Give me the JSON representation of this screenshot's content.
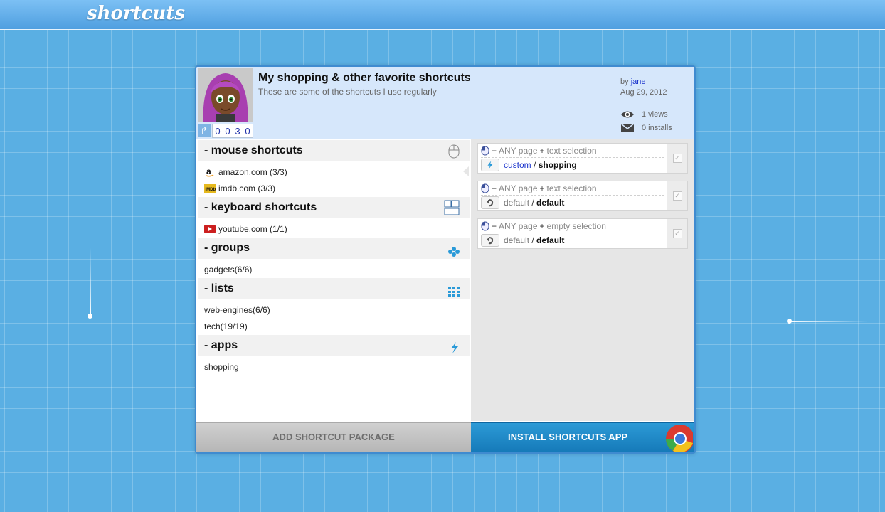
{
  "app": {
    "logo": "shortcuts"
  },
  "package": {
    "title": "My shopping & other favorite shortcuts",
    "subtitle": "These are some of the shortcuts I use regularly",
    "counter": [
      "0",
      "0",
      "3",
      "0"
    ],
    "by_prefix": "by",
    "author": "jane",
    "date": "Aug 29, 2012",
    "views": "1 views",
    "installs": "0 installs"
  },
  "sections": {
    "mouse": {
      "title": "- mouse shortcuts",
      "icon": "mouse-icon",
      "items": [
        {
          "label": "amazon.com (3/3)",
          "icon": "amazon-favicon"
        },
        {
          "label": "imdb.com (3/3)",
          "icon": "imdb-favicon"
        }
      ]
    },
    "keyboard": {
      "title": "- keyboard shortcuts",
      "icon": "keyboard-icon",
      "items": [
        {
          "label": "youtube.com (1/1)",
          "icon": "youtube-favicon"
        }
      ]
    },
    "groups": {
      "title": "- groups",
      "icon": "groups-icon",
      "items": [
        {
          "label": "gadgets(6/6)"
        }
      ]
    },
    "lists": {
      "title": "- lists",
      "icon": "grid-icon",
      "items": [
        {
          "label": "web-engines(6/6)"
        },
        {
          "label": "tech(19/19)"
        }
      ]
    },
    "apps": {
      "title": "- apps",
      "icon": "lightning-icon",
      "items": [
        {
          "label": "shopping"
        }
      ]
    }
  },
  "shortcuts": [
    {
      "plus": "+",
      "page": "ANY page",
      "plus2": "+",
      "selection": "text selection",
      "source": "custom",
      "sep": " / ",
      "action": "shopping",
      "badge_icon": "lightning-icon"
    },
    {
      "plus": "+",
      "page": "ANY page",
      "plus2": "+",
      "selection": "text selection",
      "source": "default",
      "sep": " / ",
      "action": "default",
      "badge_icon": "undo-icon"
    },
    {
      "plus": "+",
      "page": "ANY page",
      "plus2": "+",
      "selection": "empty selection",
      "source": "default",
      "sep": " / ",
      "action": "default",
      "badge_icon": "undo-icon"
    }
  ],
  "buttons": {
    "add": "ADD SHORTCUT PACKAGE",
    "install": "INSTALL SHORTCUTS APP"
  },
  "colors": {
    "accent": "#1579b8",
    "background": "#5aafe3",
    "header": "#d6e7fb"
  }
}
